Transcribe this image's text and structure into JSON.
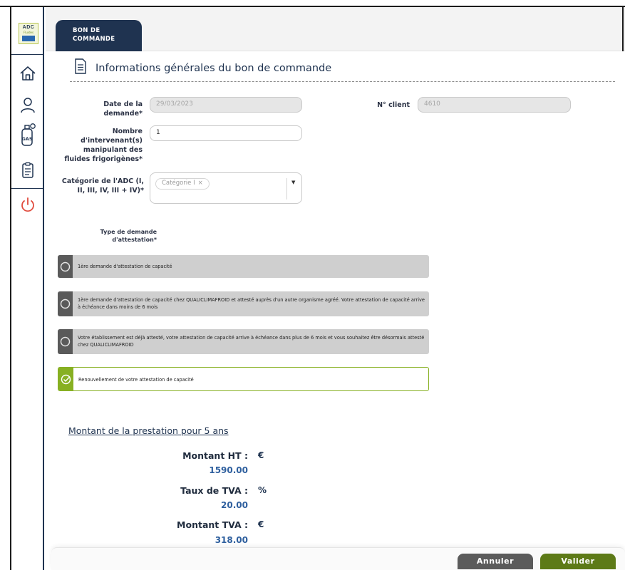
{
  "logo": {
    "line1": "ADC",
    "line2": "Fluides",
    "line3": "Q+"
  },
  "sidebar": {
    "items": [
      {
        "name": "home",
        "icon": "home-icon"
      },
      {
        "name": "profile",
        "icon": "user-icon"
      },
      {
        "name": "gas",
        "icon": "gas-bottle-icon",
        "text": "GAS"
      },
      {
        "name": "orders",
        "icon": "clipboard-icon"
      },
      {
        "name": "logout",
        "icon": "power-icon"
      }
    ],
    "logout_color": "#e04b3d"
  },
  "tabs": [
    {
      "label_line1": "BON DE",
      "label_line2": "COMMANDE",
      "active": true
    }
  ],
  "section": {
    "title": "Informations générales du bon de commande"
  },
  "form": {
    "date_label_1": "Date de la",
    "date_label_2": "demande*",
    "date_value": "29/03/2023",
    "client_label": "N° client",
    "client_value": "4610",
    "intervenants_label": [
      "Nombre",
      "d'intervenant(s)",
      "manipulant des",
      "fluides frigorigènes*"
    ],
    "intervenants_value": "1",
    "categorie_label": [
      "Catégorie de l'ADC (I,",
      "II, III, IV, III + IV)*"
    ],
    "categorie_chip": "Catégorie I",
    "categorie_chip_remove": "×",
    "type_label": [
      "Type de demande",
      "d'attestation*"
    ]
  },
  "options": [
    {
      "text": "1ère demande d'attestation de capacité",
      "selected": false
    },
    {
      "text": "1ère demande d'attestation de capacité chez QUALICLIMAFROID et attesté auprès d'un autre organisme agréé. Votre attestation de capacité arrive à échéance dans moins de 6 mois",
      "selected": false
    },
    {
      "text": "Votre établissement est déjà attesté, votre attestation de capacité arrive à échéance dans plus de 6 mois et vous souhaitez être désormais attesté chez QUALICLIMAFROID",
      "selected": false
    },
    {
      "text": "Renouvellement de votre attestation de capacité",
      "selected": true
    }
  ],
  "amount": {
    "title": "Montant de la prestation pour 5 ans",
    "ht_label": "Montant HT :",
    "ht_unit": "€",
    "ht_value": "1590.00",
    "tva_rate_label": "Taux de TVA :",
    "tva_rate_unit": "%",
    "tva_rate_value": "20.00",
    "tva_label": "Montant TVA :",
    "tva_unit": "€",
    "tva_value": "318.00"
  },
  "buttons": {
    "cancel": "Annuler",
    "validate": "Valider"
  },
  "colors": {
    "navy": "#1f3350",
    "green": "#87b022",
    "validate": "#5d7a17",
    "cancel": "#5b5b5b"
  }
}
